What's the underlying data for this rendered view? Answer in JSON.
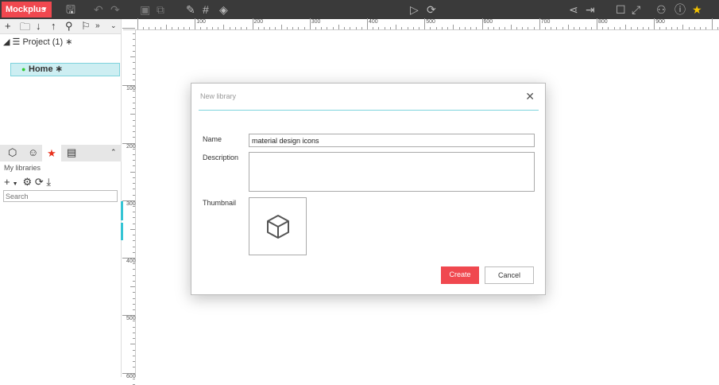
{
  "app": {
    "brand": "Mockplus"
  },
  "project": {
    "name": "Project (1)",
    "page": "Home"
  },
  "libraries": {
    "title": "My libraries",
    "search_placeholder": "Search"
  },
  "ruler": {
    "h": [
      "100",
      "200",
      "300",
      "400",
      "500",
      "600",
      "700",
      "800",
      "900"
    ],
    "v": [
      "100",
      "200",
      "300",
      "400",
      "500",
      "600"
    ]
  },
  "dialog": {
    "title": "New library",
    "name_label": "Name",
    "name_value": "material design icons",
    "description_label": "Description",
    "description_value": "",
    "thumbnail_label": "Thumbnail",
    "create": "Create",
    "cancel": "Cancel"
  },
  "colors": {
    "accent": "#f0484f",
    "teal": "#7dd3dc"
  }
}
